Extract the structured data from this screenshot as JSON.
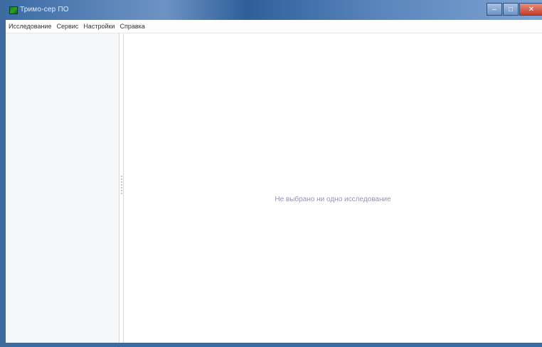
{
  "window": {
    "title": "Тримо-сер ПО"
  },
  "menubar": {
    "items": [
      {
        "label": "Исследование"
      },
      {
        "label": "Сервис"
      },
      {
        "label": "Настройки"
      },
      {
        "label": "Справка"
      }
    ]
  },
  "main": {
    "empty_message": "Не выбрано ни одно исследование"
  },
  "icons": {
    "app": "app-icon",
    "minimize": "minimize-icon",
    "maximize": "maximize-icon",
    "close": "close-icon"
  },
  "colors": {
    "titlebar": "#3b6ba4",
    "empty_message": "#9a8fb4"
  }
}
